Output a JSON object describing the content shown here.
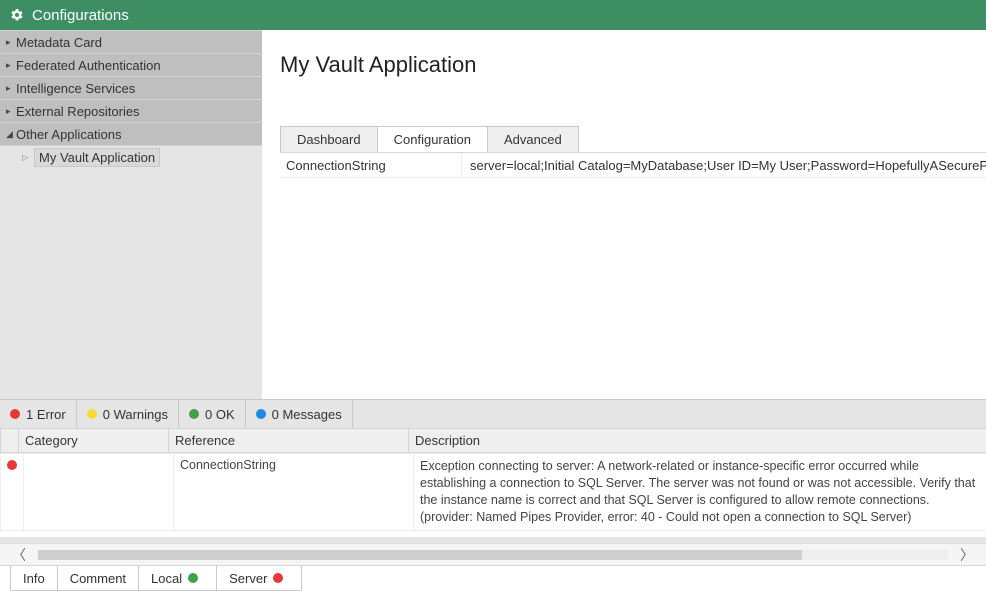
{
  "titlebar": {
    "title": "Configurations"
  },
  "sidebar": {
    "items": [
      {
        "label": "Metadata Card"
      },
      {
        "label": "Federated Authentication"
      },
      {
        "label": "Intelligence Services"
      },
      {
        "label": "External Repositories"
      },
      {
        "label": "Other Applications"
      }
    ],
    "subitem": {
      "label": "My Vault Application"
    }
  },
  "main": {
    "title": "My Vault Application",
    "tabs": [
      {
        "label": "Dashboard"
      },
      {
        "label": "Configuration"
      },
      {
        "label": "Advanced"
      }
    ],
    "config_row": {
      "key": "ConnectionString",
      "value": "server=local;Initial Catalog=MyDatabase;User ID=My User;Password=HopefullyASecurePassword"
    }
  },
  "status": {
    "badges": {
      "errors": "1 Error",
      "warnings": "0 Warnings",
      "ok": "0 OK",
      "messages": "0 Messages"
    },
    "columns": {
      "category": "Category",
      "reference": "Reference",
      "description": "Description"
    },
    "row": {
      "category": "",
      "reference": "ConnectionString",
      "description": "Exception connecting to server: A network-related or instance-specific error occurred while establishing a connection to SQL Server. The server was not found or was not accessible. Verify that the instance name is correct and that SQL Server is configured to allow remote connections. (provider: Named Pipes Provider, error: 40 - Could not open a connection to SQL Server)"
    }
  },
  "bottom_tabs": {
    "info": "Info",
    "comment": "Comment",
    "local": "Local",
    "server": "Server"
  }
}
